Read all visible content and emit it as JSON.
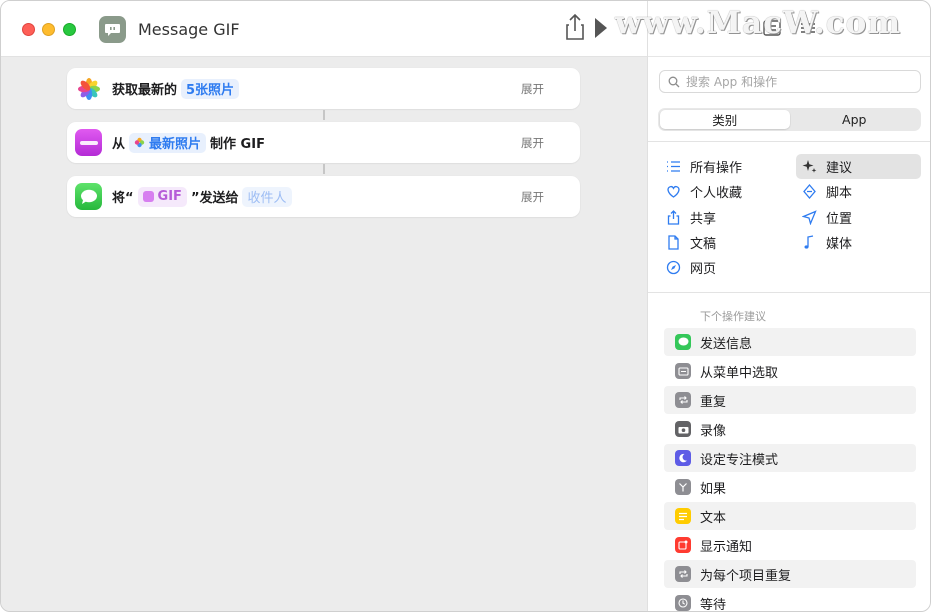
{
  "window": {
    "title": "Message GIF"
  },
  "actions": [
    {
      "id": "get-photos",
      "prefix": "获取最新的",
      "token": "5张照片",
      "middle": "",
      "token2": "",
      "suffix": "",
      "expand": "展开",
      "icon_color": "#ffffff"
    },
    {
      "id": "make-gif",
      "prefix": "从",
      "token": "最新照片",
      "middle": "",
      "token2": "",
      "suffix": "制作 GIF",
      "expand": "展开",
      "icon_color": "#c944e6"
    },
    {
      "id": "send-message",
      "prefix": "将“",
      "token": "GIF",
      "middle": "”发送给",
      "token2": "收件人",
      "suffix": "",
      "expand": "展开",
      "icon_color": "#34c759"
    }
  ],
  "library": {
    "search_placeholder": "搜索 App 和操作",
    "tabs": [
      {
        "label": "类别",
        "active": true
      },
      {
        "label": "App",
        "active": false
      }
    ],
    "categories": [
      {
        "label": "所有操作",
        "icon": "list-icon"
      },
      {
        "label": "建议",
        "icon": "sparkle-icon",
        "selected": true
      },
      {
        "label": "个人收藏",
        "icon": "heart-icon"
      },
      {
        "label": "脚本",
        "icon": "script-icon"
      },
      {
        "label": "共享",
        "icon": "share-icon"
      },
      {
        "label": "位置",
        "icon": "location-icon"
      },
      {
        "label": "文稿",
        "icon": "document-icon"
      },
      {
        "label": "媒体",
        "icon": "music-icon"
      },
      {
        "label": "网页",
        "icon": "compass-icon"
      }
    ],
    "suggestions_header": "下个操作建议",
    "suggestions": [
      {
        "label": "发送信息",
        "icon": "messages-icon",
        "color": "#34c759"
      },
      {
        "label": "从菜单中选取",
        "icon": "menu-icon",
        "color": "#8e8e93"
      },
      {
        "label": "重复",
        "icon": "repeat-icon",
        "color": "#8e8e93"
      },
      {
        "label": "录像",
        "icon": "camera-icon",
        "color": "#636366"
      },
      {
        "label": "设定专注模式",
        "icon": "moon-icon",
        "color": "#5e5ce6"
      },
      {
        "label": "如果",
        "icon": "branch-icon",
        "color": "#8e8e93"
      },
      {
        "label": "文本",
        "icon": "text-icon",
        "color": "#ffcc00"
      },
      {
        "label": "显示通知",
        "icon": "notification-icon",
        "color": "#ff3b30"
      },
      {
        "label": "为每个项目重复",
        "icon": "repeat-each-icon",
        "color": "#8e8e93"
      },
      {
        "label": "等待",
        "icon": "clock-icon",
        "color": "#8e8e93"
      }
    ]
  },
  "watermark": "www.MacW.com"
}
